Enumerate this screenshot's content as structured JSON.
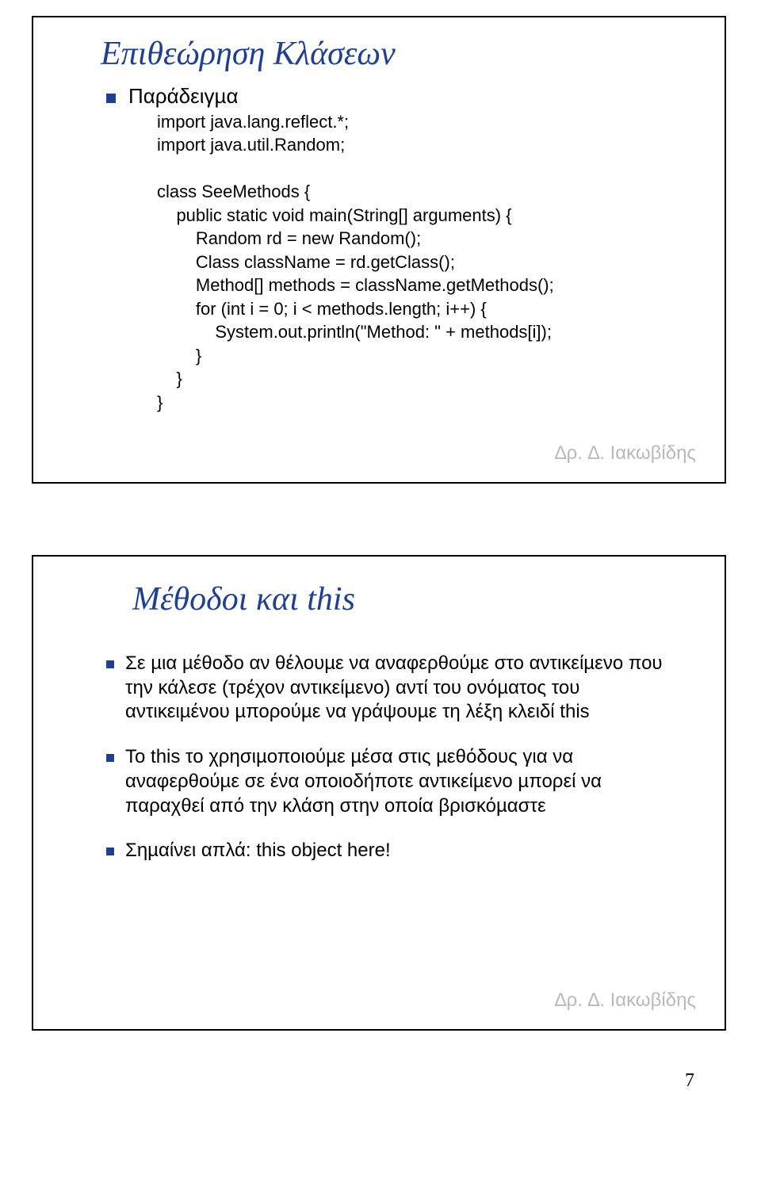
{
  "slide1": {
    "title": "Επιθεώρηση Κλάσεων",
    "subtitle": "Παράδειγµα",
    "code": "import java.lang.reflect.*;\nimport java.util.Random;\n\nclass SeeMethods {\n    public static void main(String[] arguments) {\n        Random rd = new Random();\n        Class className = rd.getClass();\n        Method[] methods = className.getMethods();\n        for (int i = 0; i < methods.length; i++) {\n            System.out.println(\"Method: \" + methods[i]);\n        }\n    }\n}",
    "author": "∆ρ. ∆. Ιακωβίδης"
  },
  "slide2": {
    "title": "Μέθοδοι και this",
    "b1": "Σε µια µέθοδο αν θέλουµε να αναφερθούµε στο αντικείµενο που την κάλεσε (τρέχον αντικείµενο) αντί του ονόµατος του αντικειµένου µπορούµε να γράψουµε τη λέξη κλειδί this",
    "b2": "Το this το χρησιµοποιούµε µέσα στις µεθόδους για να αναφερθούµε σε ένα οποιοδήποτε αντικείµενο µπορεί να παραχθεί από την κλάση στην οποία βρισκόµαστε",
    "b3": "Σηµαίνει απλά: this object here!",
    "author": "∆ρ. ∆. Ιακωβίδης"
  },
  "page_number": "7"
}
